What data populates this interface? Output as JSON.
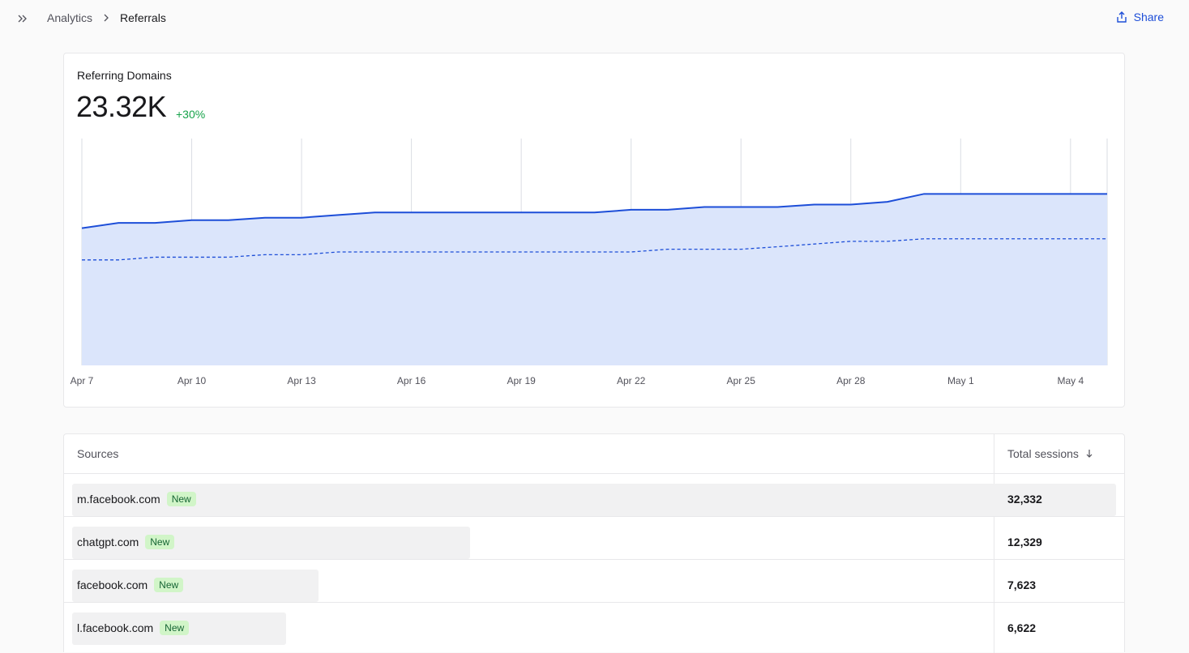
{
  "header": {
    "breadcrumb_parent": "Analytics",
    "breadcrumb_current": "Referrals",
    "share_label": "Share",
    "icons": [
      "expand-sidebar-icon",
      "chevron-right-icon",
      "share-icon"
    ],
    "accent_color": "#1d4ed8"
  },
  "metric": {
    "label": "Referring Domains",
    "value": "23.32K",
    "delta": "+30%",
    "delta_color": "#16a34a"
  },
  "chart_data": {
    "type": "area",
    "title": "",
    "xlabel": "",
    "ylabel": "",
    "x": [
      "Apr 7",
      "Apr 8",
      "Apr 9",
      "Apr 10",
      "Apr 11",
      "Apr 12",
      "Apr 13",
      "Apr 14",
      "Apr 15",
      "Apr 16",
      "Apr 17",
      "Apr 18",
      "Apr 19",
      "Apr 20",
      "Apr 21",
      "Apr 22",
      "Apr 23",
      "Apr 24",
      "Apr 25",
      "Apr 26",
      "Apr 27",
      "Apr 28",
      "Apr 29",
      "Apr 30",
      "May 1",
      "May 2",
      "May 3",
      "May 4",
      "May 5"
    ],
    "tick_labels": [
      "Apr 7",
      "Apr 10",
      "Apr 13",
      "Apr 16",
      "Apr 19",
      "Apr 22",
      "Apr 25",
      "Apr 28",
      "May 1",
      "May 4"
    ],
    "ylim": [
      0,
      100
    ],
    "y_axis_labels_shown": false,
    "grid": "vertical",
    "series": [
      {
        "style": "solid-area",
        "color": "#1d4ed8",
        "fill": "#dbe5fb",
        "values": [
          60.5,
          62.8,
          62.8,
          64.0,
          64.0,
          65.1,
          65.1,
          66.3,
          67.4,
          67.4,
          67.4,
          67.4,
          67.4,
          67.4,
          67.4,
          68.6,
          68.6,
          69.8,
          69.8,
          69.8,
          70.9,
          70.9,
          72.1,
          75.6,
          75.6,
          75.6,
          75.6,
          75.6,
          75.6
        ]
      },
      {
        "style": "dashed",
        "color": "#1d4ed8",
        "values": [
          46.5,
          46.5,
          47.7,
          47.7,
          47.7,
          48.8,
          48.8,
          50.0,
          50.0,
          50.0,
          50.0,
          50.0,
          50.0,
          50.0,
          50.0,
          50.0,
          51.2,
          51.2,
          51.2,
          52.3,
          53.5,
          54.7,
          54.7,
          55.8,
          55.8,
          55.8,
          55.8,
          55.8,
          55.8
        ]
      }
    ]
  },
  "table": {
    "col_sources": "Sources",
    "col_sessions": "Total sessions",
    "sort_icon": "arrow-down-icon",
    "rows": [
      {
        "source": "m.facebook.com",
        "badge": "New",
        "sessions": "32,332",
        "share": 1.0
      },
      {
        "source": "chatgpt.com",
        "badge": "New",
        "sessions": "12,329",
        "share": 0.3813
      },
      {
        "source": "facebook.com",
        "badge": "New",
        "sessions": "7,623",
        "share": 0.2358
      },
      {
        "source": "l.facebook.com",
        "badge": "New",
        "sessions": "6,622",
        "share": 0.2048
      }
    ]
  }
}
